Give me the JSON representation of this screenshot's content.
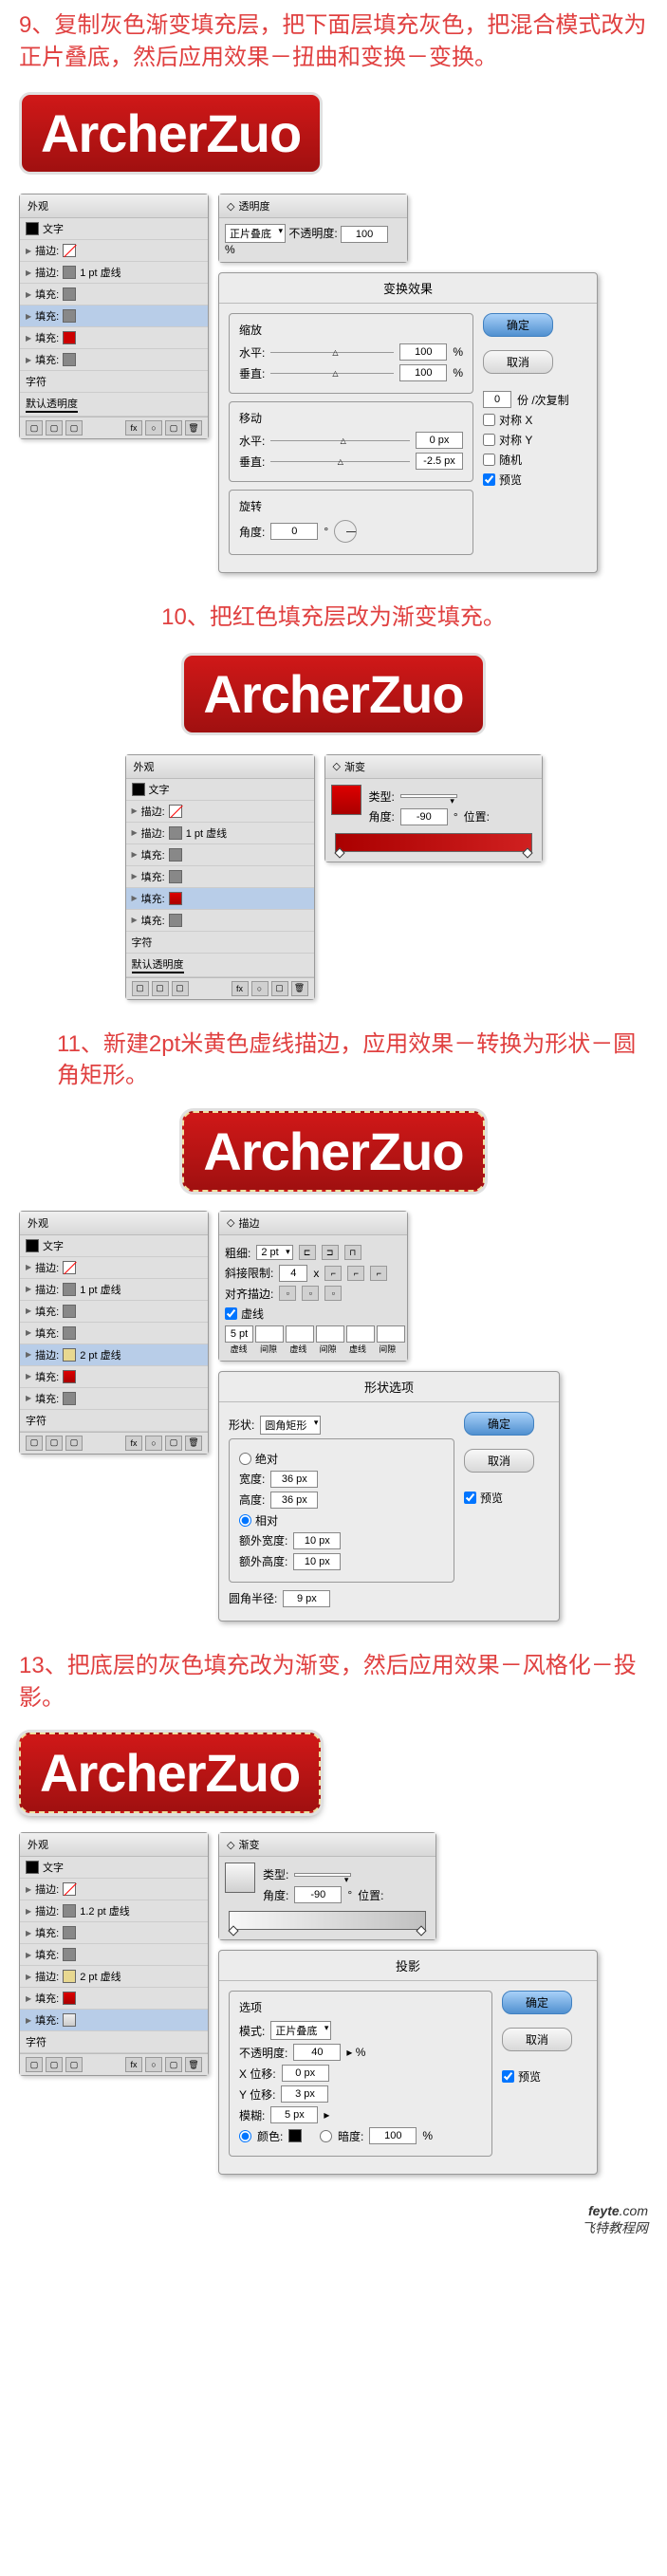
{
  "step9": {
    "text": "9、复制灰色渐变填充层，把下面层填充灰色，把混合模式改为正片叠底，然后应用效果－扭曲和变换－变换。",
    "logo": "ArcherZuo"
  },
  "appearance_panel": {
    "title": "外观",
    "text_row": "文字",
    "stroke_label": "描边:",
    "fill_label": "填充:",
    "stroke_1pt": "1 pt 虚线",
    "char_label": "字符",
    "opacity_label": "默认透明度"
  },
  "transparency_panel": {
    "title": "透明度",
    "blend_mode": "正片叠底",
    "opacity_label": "不透明度:",
    "opacity_value": "100"
  },
  "transform_dialog": {
    "title": "变换效果",
    "scale_title": "缩放",
    "horizontal": "水平:",
    "vertical": "垂直:",
    "h_value": "100",
    "v_value": "100",
    "move_title": "移动",
    "move_h": "0 px",
    "move_v": "-2.5 px",
    "rotate_title": "旋转",
    "angle_label": "角度:",
    "angle_value": "0",
    "ok": "确定",
    "cancel": "取消",
    "copies_value": "0",
    "copies_label": "份 /次复制",
    "mirror_x": "对称 X",
    "mirror_y": "对称 Y",
    "random": "随机",
    "preview": "预览"
  },
  "step10": {
    "text": "10、把红色填充层改为渐变填充。",
    "logo": "ArcherZuo"
  },
  "gradient_panel": {
    "title": "渐变",
    "type_label": "类型:",
    "angle_label": "角度:",
    "angle_value": "-90",
    "position_label": "位置:"
  },
  "step11": {
    "text": "11、新建2pt米黄色虚线描边，应用效果－转换为形状－圆角矩形。",
    "logo": "ArcherZuo"
  },
  "stroke_panel": {
    "title": "描边",
    "weight_label": "粗细:",
    "weight_value": "2 pt",
    "miter_label": "斜接限制:",
    "miter_value": "4",
    "align_label": "对齐描边:",
    "dash_label": "虚线",
    "dash_value": "5 pt",
    "dash_col": "虚线",
    "gap_col": "间隙"
  },
  "appearance11": {
    "stroke_2pt": "2 pt 虚线",
    "stroke_1pt": "1 pt 虚线"
  },
  "shape_dialog": {
    "title": "形状选项",
    "shape_label": "形状:",
    "shape_value": "圆角矩形",
    "absolute": "绝对",
    "width_label": "宽度:",
    "width_value": "36 px",
    "height_label": "高度:",
    "height_value": "36 px",
    "relative": "相对",
    "extra_w_label": "额外宽度:",
    "extra_w_value": "10 px",
    "extra_h_label": "额外高度:",
    "extra_h_value": "10 px",
    "corner_label": "圆角半径:",
    "corner_value": "9 px",
    "ok": "确定",
    "cancel": "取消",
    "preview": "预览"
  },
  "step13": {
    "text": "13、把底层的灰色填充改为渐变，然后应用效果－风格化－投影。",
    "logo": "ArcherZuo"
  },
  "appearance13": {
    "stroke_12pt": "1.2 pt 虚线",
    "stroke_2pt": "2 pt 虚线"
  },
  "gradient13": {
    "title": "渐变",
    "type_label": "类型:",
    "angle_label": "角度:",
    "angle_value": "-90",
    "position_label": "位置:"
  },
  "shadow_dialog": {
    "title": "投影",
    "options_label": "选项",
    "mode_label": "模式:",
    "mode_value": "正片叠底",
    "opacity_label": "不透明度:",
    "opacity_value": "40",
    "x_label": "X 位移:",
    "x_value": "0 px",
    "y_label": "Y 位移:",
    "y_value": "3 px",
    "blur_label": "模糊:",
    "blur_value": "5 px",
    "color_label": "颜色:",
    "darkness_label": "暗度:",
    "darkness_value": "100",
    "ok": "确定",
    "cancel": "取消",
    "preview": "预览"
  },
  "watermark": "feyte.com\n飞特教程网"
}
